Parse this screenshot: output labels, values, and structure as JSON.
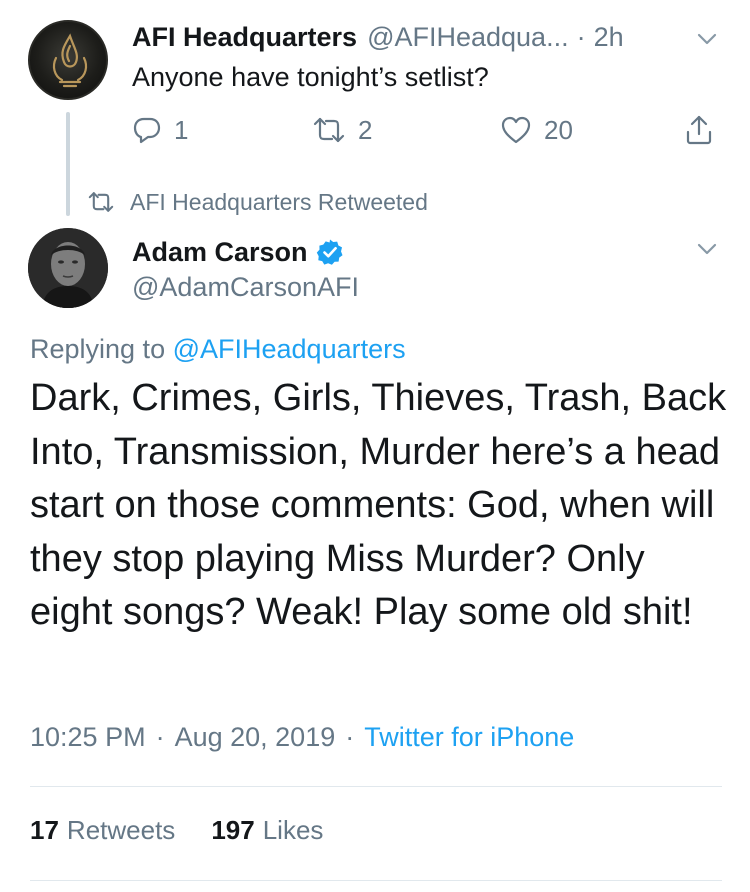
{
  "first_tweet": {
    "author_name": "AFI Headquarters",
    "author_handle": "@AFIHeadqua...",
    "separator": "·",
    "time_ago": "2h",
    "text": "Anyone have tonight’s setlist?",
    "reply_count": "1",
    "retweet_count": "2",
    "like_count": "20",
    "icons": {
      "reply": "reply-icon",
      "retweet": "retweet-icon",
      "like": "heart-icon",
      "share": "share-icon",
      "menu": "chevron-down-icon"
    }
  },
  "retweet_context": {
    "label": "AFI Headquarters Retweeted",
    "icon": "retweet-icon"
  },
  "main_tweet": {
    "author_name": "Adam Carson",
    "author_handle": "@AdamCarsonAFI",
    "verified": true,
    "replying_prefix": "Replying to ",
    "replying_to": "@AFIHeadquarters",
    "text": "Dark, Crimes, Girls, Thieves, Trash, Back Into, Transmission, Murder here’s a head start on those comments: God, when will they stop playing Miss Murder? Only eight songs? Weak! Play some old shit!",
    "time": "10:25 PM",
    "dot": "·",
    "date": "Aug 20, 2019",
    "source": "Twitter for iPhone",
    "retweets_count": "17",
    "retweets_label": "Retweets",
    "likes_count": "197",
    "likes_label": "Likes"
  },
  "colors": {
    "accent": "#1da1f2",
    "text": "#14171a",
    "muted": "#657786",
    "divider": "#e1e8ed"
  }
}
